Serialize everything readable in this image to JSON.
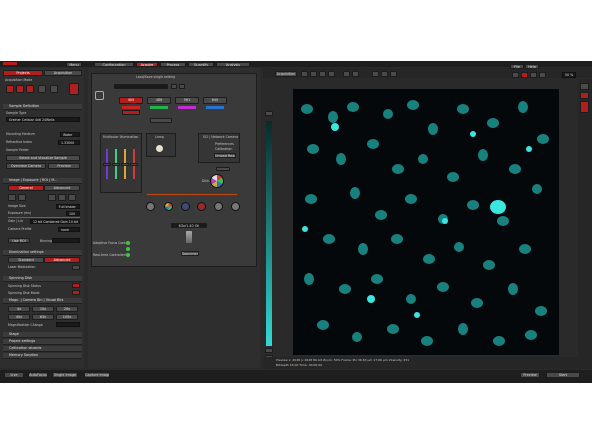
{
  "top": {
    "tabs": [
      "Configuration",
      "Acquire",
      "Process",
      "Quantify",
      "Analysis"
    ],
    "active_tab": "Acquire",
    "menu_label": "Menu"
  },
  "left": {
    "tabs": [
      "Projects",
      "Acquisition"
    ],
    "mode_label": "Acquisition Mode",
    "sample_definition": "Sample Definition",
    "sample_type_label": "Sample Type",
    "sample_type_value": "Greiner Cellstar 4x6 24Wells",
    "mounting_medium_label": "Mounting Medium",
    "mounting_medium_value": "Water",
    "refractive_label": "Refractive Index",
    "refractive_value": "1.33000",
    "sample finder": "Sample Finder",
    "select_sample": "Select and Visualize Sample",
    "overview_camera": "Overview Camera",
    "preview": "Preview",
    "image_section": "Image | Exposure | ROI | M...",
    "general": "General",
    "advanced": "Advanced",
    "image_size_label": "Image Size",
    "image_size_value": "Full Image",
    "exposure_label": "Exposure (ms)",
    "exposure_value": "100",
    "gain_label": "Gain | Lin",
    "gain_value": "12 bit Combined Gain 10 bit",
    "camera_label": "Camera Profile",
    "camera_value": "none",
    "use_roi": "Use ROI",
    "binning": "Binning",
    "illumination": "Illumination settings",
    "standard": "Standard",
    "illum_advanced": "Advanced",
    "laser_modulation": "Laser Modulation",
    "spinning_disk": "Spinning Disk",
    "sd_status": "Spinning Disk Status",
    "sd_mode": "Spinning Disk Mode",
    "magnification_header": "Magn. | Camera Bin | Visual Bits",
    "mag_buttons": [
      "4x",
      "10x",
      "20x",
      "40x",
      "63x",
      "100x"
    ],
    "magnification_change": "Magnification Change",
    "stage": "Stage",
    "project_settings": "Project settings",
    "calibration": "Calibration wizards",
    "memory": "Memory Sorption"
  },
  "center": {
    "title": "Load/Save single setting",
    "channels": [
      "405",
      "488",
      "561",
      "640"
    ],
    "multicolor": "Multicolor Illumination",
    "lamp": "Lamp",
    "camera_box": "SCI | Network Camera",
    "preferences": "Preferences",
    "calibration": "Calibration",
    "unload": "Unload Readings",
    "objective": "63x/1.40 Oil",
    "specimen": "Specimen",
    "adaptive_focus": "Adaptive Focus Control",
    "realtime": "Real-time Controlled",
    "dim_labels": [
      "4.0X",
      "4.0X",
      "3.8X",
      "3.8X"
    ]
  },
  "viewer": {
    "tab": "Acquisition",
    "top_right": [
      "File",
      "Help"
    ],
    "zoom": "50 %",
    "status": "Preview  x: 2048  y: 2048  8G bit  Zoom: 50%   Frame: Pix 36.63 µm 17.66 µm   Intensity: 451",
    "status2": "Bitdepth 16 bit   Time: 00:00:00"
  },
  "bottom": {
    "left_buttons": [
      "Live",
      "AutoFocus",
      "Single Image",
      "Capture Image"
    ],
    "right_buttons": [
      "Preview",
      "Start"
    ]
  },
  "colors": {
    "accent": "#b01e1e",
    "nucleus": "#33d9d3",
    "background": "#2a2a2a"
  }
}
